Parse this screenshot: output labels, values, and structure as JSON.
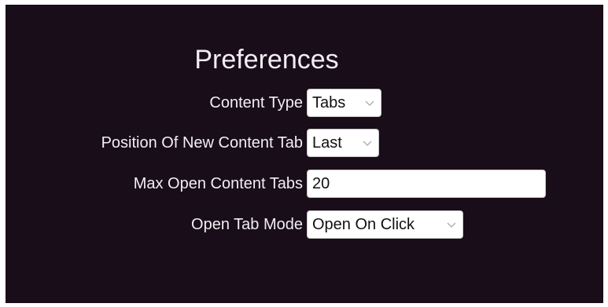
{
  "preferences": {
    "title": "Preferences",
    "content_type": {
      "label": "Content Type",
      "value": "Tabs"
    },
    "position_new_tab": {
      "label": "Position Of New Content Tab",
      "value": "Last"
    },
    "max_open_tabs": {
      "label": "Max Open Content Tabs",
      "value": "20"
    },
    "open_tab_mode": {
      "label": "Open Tab Mode",
      "value": "Open On Click"
    }
  },
  "colors": {
    "panel_background": "#190d19",
    "text": "#f2eef2",
    "control_background": "#ffffff"
  },
  "icons": {
    "dropdown": "chevron-down-icon"
  }
}
